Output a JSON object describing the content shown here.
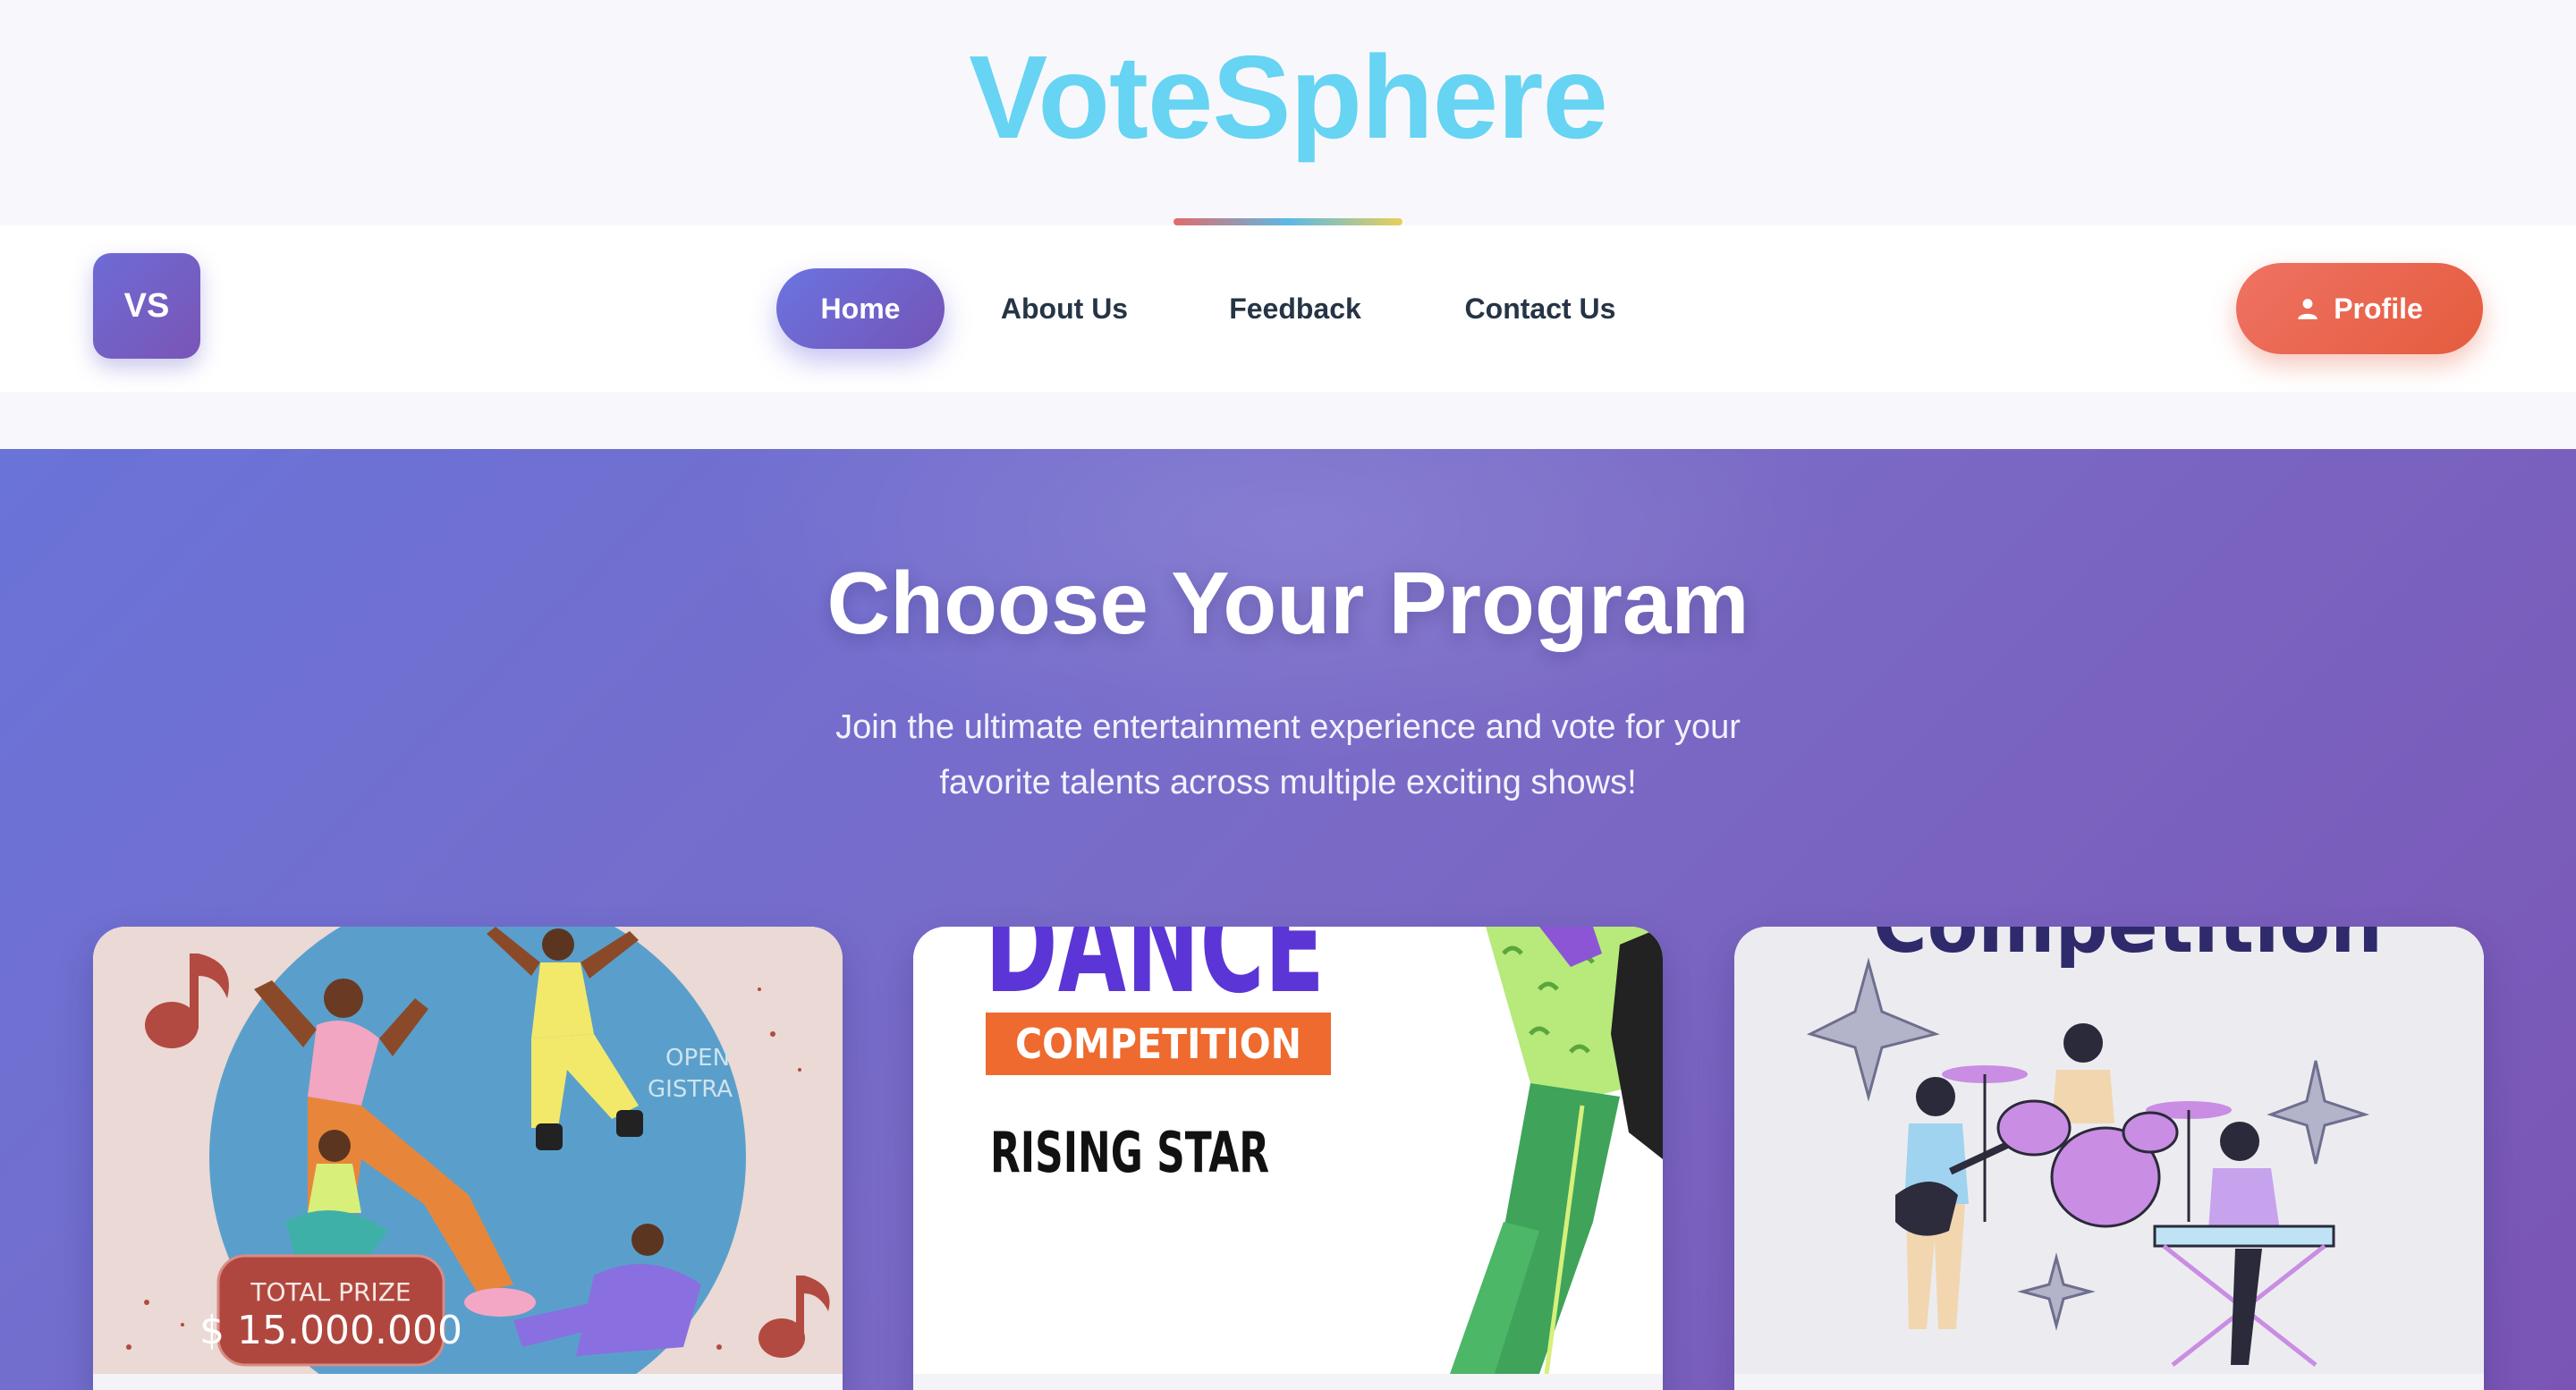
{
  "brand": {
    "title": "VoteSphere",
    "logo_text": "VS"
  },
  "nav": {
    "items": [
      {
        "label": "Home",
        "active": true
      },
      {
        "label": "About Us",
        "active": false
      },
      {
        "label": "Feedback",
        "active": false
      },
      {
        "label": "Contact Us",
        "active": false
      }
    ],
    "profile_label": "Profile",
    "profile_icon": "user-icon"
  },
  "hero": {
    "title": "Choose Your Program",
    "subtitle_line1": "Join the ultimate entertainment experience and vote for your",
    "subtitle_line2": "favorite talents across multiple exciting shows!"
  },
  "programs": [
    {
      "poster": {
        "side_text_1": "OPEN",
        "side_text_2": "GISTRA",
        "prize_label": "TOTAL PRIZE",
        "prize_amount": "$ 15.000.000"
      }
    },
    {
      "poster": {
        "headline": "DANCE",
        "banner": "COMPETITION",
        "tagline": "RISING STAR"
      }
    },
    {
      "poster": {
        "headline": "Competition"
      }
    }
  ],
  "colors": {
    "brand": "#66d4f2",
    "nav_active": "#6b74e0",
    "profile": "#e45c3e",
    "hero_start": "#6a73d8",
    "hero_end": "#7a55b5"
  }
}
